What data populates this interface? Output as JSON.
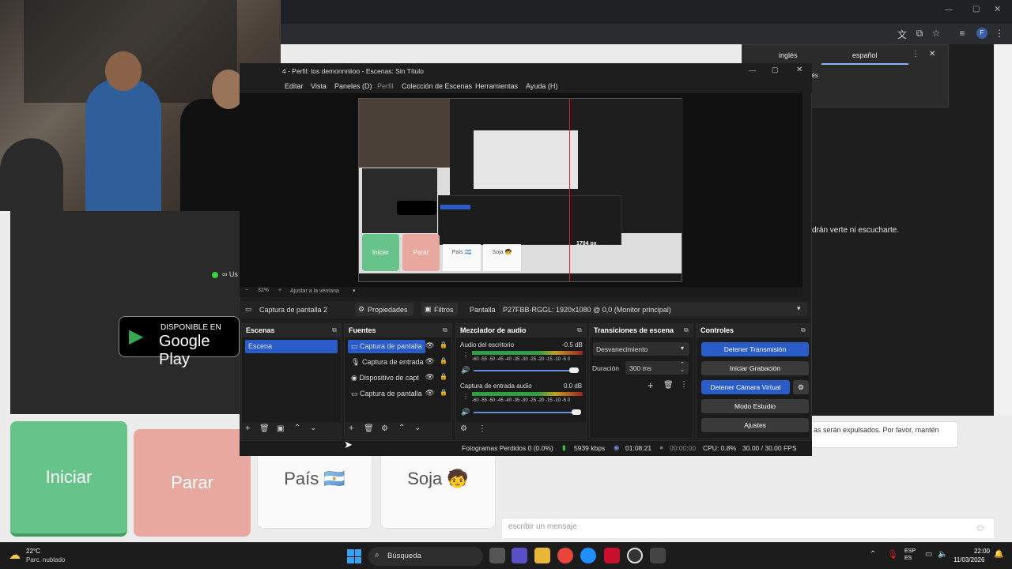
{
  "browser": {
    "translate": {
      "tab_en": "inglés",
      "tab_es": "español",
      "subtitle": "del inglés"
    }
  },
  "page": {
    "right_text": "drán verte ni escucharte.",
    "chat_bubble": "as serán expulsados. Por favor, mantén",
    "chat_placeholder": "escribir un mensaje",
    "buttons": {
      "iniciar": "Iniciar",
      "parar": "Parar",
      "pais": "País 🇦🇷",
      "soja": "Soja 🧒"
    },
    "google_badge": {
      "small": "DISPONIBLE EN",
      "big": "Google Play"
    },
    "status_fragment": "∞ Us"
  },
  "obs": {
    "title": "4 - Perfil: los demonnniioo - Escenas: Sin Título",
    "menu": [
      "Editar",
      "Vista",
      "Paneles (D)",
      "Perfil",
      "Colección de Escenas",
      "Herramientas",
      "Ayuda (H)"
    ],
    "zoom": {
      "minus": "−",
      "percent": "32%",
      "plus": "+",
      "fit": "Ajustar a la ventana"
    },
    "preview": {
      "inner_iniciar": "Iniciar",
      "inner_parar": "Parar",
      "inner_pais": "País 🇦🇷",
      "inner_soja": "Soja 🧒",
      "px_label": "1704 px"
    },
    "source_bar": {
      "source": "Captura de pantalla 2",
      "properties": "Propiedades",
      "filters": "Filtros",
      "screen_label": "Pantalla",
      "screen_value": "P27FBB-RGGL: 1920x1080 @ 0,0 (Monitor principal)"
    },
    "scenes": {
      "header": "Escenas",
      "items": [
        "Escena"
      ]
    },
    "sources": {
      "header": "Fuentes",
      "items": [
        "Captura de pantalla",
        "Captura de entrada",
        "Dispositivo de capt",
        "Captura de pantalla"
      ]
    },
    "mixer": {
      "header": "Mezclador de audio",
      "channels": [
        {
          "name": "Audio del escritorio",
          "db": "-0.5 dB"
        },
        {
          "name": "Captura de entrada audio",
          "db": "0.0 dB"
        }
      ],
      "scale": "-60 -55 -50 -45 -40 -35 -30 -25 -20 -15 -10 -5 0"
    },
    "transitions": {
      "header": "Transiciones de escena",
      "type": "Desvanecimiento",
      "duration_label": "Duración",
      "duration_value": "300 ms"
    },
    "controls": {
      "header": "Controles",
      "stop_stream": "Detener Transmisión",
      "start_record": "Iniciar Grabación",
      "stop_vcam": "Detener Cámara Virtual",
      "studio": "Modo Estudio",
      "settings": "Ajustes"
    },
    "status": {
      "dropped": "Fotogramas Perdidos 0 (0.0%)",
      "kbps": "5939 kbps",
      "stream_time": "01:08:21",
      "rec_time": "00:00:00",
      "cpu": "CPU: 0.8%",
      "fps": "30.00 / 30.00 FPS"
    }
  },
  "taskbar": {
    "temp": "22°C",
    "weather": "Parc. nublado",
    "search": "Búsqueda",
    "lang": [
      "ESP",
      "ES"
    ],
    "time": "22:00",
    "date": "11/03/2026"
  },
  "colors": {
    "obs_accent": "#2a5cc8",
    "iniciar": "#66c48a",
    "parar": "#e8a79f"
  }
}
